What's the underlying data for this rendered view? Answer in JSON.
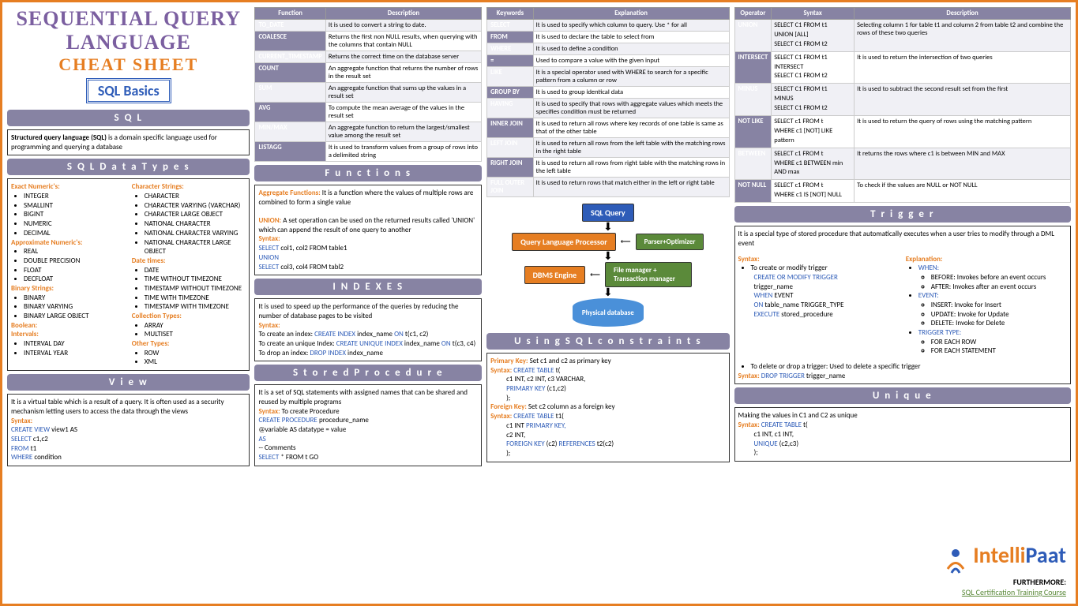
{
  "title": {
    "l1": "SEQUENTIAL QUERY",
    "l2": "LANGUAGE",
    "l3": "CHEAT SHEET",
    "badge": "SQL Basics"
  },
  "sql": {
    "hdr": "S Q L",
    "body": "Structured query language (SQL)",
    "body2": " is a domain specific language used for programming and querying a database"
  },
  "types": {
    "hdr": "S Q L   D a t a   T y p e s",
    "exact": {
      "t": "Exact Numeric's:",
      "i": [
        "INTEGER",
        "SMALLINT",
        "BIGINT",
        "NUMERIC",
        "DECIMAL"
      ]
    },
    "approx": {
      "t": "Approximate Numeric's:",
      "i": [
        "REAL",
        "DOUBLE PRECISION",
        "FLOAT",
        "DECFLOAT"
      ]
    },
    "binary": {
      "t": "Binary Strings:",
      "i": [
        "BINARY",
        "BINARY VARYING",
        "BINARY LARGE OBJECT"
      ]
    },
    "bool": {
      "t": "Boolean:"
    },
    "interval": {
      "t": "Intervals:",
      "i": [
        "INTERVAL DAY",
        "INTERVAL YEAR"
      ]
    },
    "char": {
      "t": "Character Strings:",
      "i": [
        "CHARACTER",
        "CHARACTER VARYING (VARCHAR)",
        "CHARACTER LARGE OBJECT",
        "NATIONAL CHARACTER",
        "NATIONAL CHARACTER VARYING",
        "NATIONAL CHARACTER LARGE OBJECT"
      ]
    },
    "date": {
      "t": "Date times:",
      "i": [
        "DATE",
        "TIME WITHOUT TIMEZONE",
        "TIMESTAMP WITHOUT TIMEZONE",
        "TIME WITH TIMEZONE",
        "TIMESTAMP WITH TIMEZONE"
      ]
    },
    "coll": {
      "t": "Collection Types:",
      "i": [
        "ARRAY",
        "MULTISET"
      ]
    },
    "other": {
      "t": "Other Types:",
      "i": [
        "ROW",
        "XML"
      ]
    }
  },
  "view": {
    "hdr": "V i e w",
    "body": "It is a virtual table which is a result of a query. It is often used as a security mechanism letting users to access the data through the views",
    "s": "Syntax:",
    "l1": "CREATE VIEW",
    "l1b": " view1 AS",
    "l2": "SELECT",
    "l2b": " c1,c2",
    "l3": "FROM",
    "l3b": " t1",
    "l4": "WHERE",
    "l4b": " condition"
  },
  "ftbl": {
    "h1": "Function",
    "h2": "Description",
    "rows": [
      [
        "TO_DATE",
        "It is used to convert a string to date."
      ],
      [
        "COALESCE",
        "Returns the first non NULL results, when querying with the columns that contain NULL"
      ],
      [
        "CURRENT_TIMESTAMP",
        "Returns the correct time on the database server"
      ],
      [
        "COUNT",
        "An aggregate function that returns the number of rows in the result set"
      ],
      [
        "SUM",
        "An aggregate function that sums up the values in a result set"
      ],
      [
        "AVG",
        "To compute the mean average of the values in the result set"
      ],
      [
        "MIN/MAX",
        "An aggregate function to return the largest/smallest value among the result set"
      ],
      [
        "LISTAGG",
        "It is used to transform values from a group of rows into a delimited string"
      ]
    ]
  },
  "func": {
    "hdr": "F u n c t i o n s",
    "af": "Aggregate Functions:",
    "afb": " It is a function where the values of multiple rows are combined to form a single value",
    "un": "UNION:",
    "unb": " A set operation can be used on the returned results called 'UNION' which can append the result of one query to another",
    "s": "Syntax:",
    "l1": "SELECT",
    "l1b": " col1, col2 FROM table1",
    "l2": "UNION",
    "l3": "SELECT",
    "l3b": " col3, col4 FROM tabl2"
  },
  "idx": {
    "hdr": "I N D E X E S",
    "body": "It is used to speed up the performance of the queries by reducing the number of database pages to be visited",
    "s": "Syntax:",
    "l1": "To create an index: ",
    "l1b": "CREATE INDEX",
    "l1c": " index_name ",
    "l1d": "ON",
    "l1e": " t(c1, c2)",
    "l2": "To create an unique Index: ",
    "l2b": "CREATE UNIQUE INDEX",
    "l2c": " index_name ",
    "l2d": "ON",
    "l2e": " t(c3, c4)",
    "l3": "To drop an index: ",
    "l3b": "DROP INDEX",
    "l3c": " index_name"
  },
  "sp": {
    "hdr": "S t o r e d   P r o c e d u r e",
    "body": "It is a set of SQL statements with assigned names that can be shared and reused by multiple programs",
    "s": "Syntax:",
    "sb": " To create Procedure",
    "l1": "CREATE PROCEDURE",
    "l1b": " procedure_name",
    "l2": "@variable AS datatype = value",
    "l3": "AS",
    "l4": "-- Comments",
    "l5": "SELECT",
    "l5b": " * FROM t GO"
  },
  "ktbl": {
    "h1": "Keywords",
    "h2": "Explanation",
    "rows": [
      [
        "SELECT",
        "It is used to specify which column to query. Use * for all"
      ],
      [
        "FROM",
        "It is used to declare the table to select from"
      ],
      [
        "WHERE",
        "It is used to define a condition"
      ],
      [
        "=",
        "Used to compare a value with the given input"
      ],
      [
        "LIKE",
        "It is a special operator used with WHERE to search for a specific pattern from a column or row"
      ],
      [
        "GROUP BY",
        "It is used to group identical data"
      ],
      [
        "HAVING",
        "It is used to specify that rows with aggregate values which meets the specifies condition must be returned"
      ],
      [
        "INNER JOIN",
        "It is used to return all rows where key records of one table is same as that of the other table"
      ],
      [
        "LEFT JOIN",
        "It is used to return all rows from the left table with the matching rows in the right table"
      ],
      [
        "RIGHT JOIN",
        "It is used to return all rows from right table with the matching rows in the left table"
      ],
      [
        "FULL OUTER JOIN",
        "It is used to return rows that match either in the left or right table"
      ]
    ]
  },
  "diag": {
    "q": "SQL Query",
    "p": "Query Language Processor",
    "po": "Parser+Optimizer",
    "e": "DBMS Engine",
    "fm": "File manager + Transaction manager",
    "d": "Physical database"
  },
  "con": {
    "hdr": "U s i n g   S Q L   c o n s t r a i n t s",
    "pk": "Primary Key:",
    "pkb": " Set c1 and c2 as primary key",
    "s": "Syntax: ",
    "ct": "CREATE TABLE",
    "l1": "c1 INT, c2 INT, c3 VARCHAR,",
    "l2": "PRIMARY KEY",
    "l2b": " (c1,c2)",
    "fk": "Foreign Key:",
    "fkb": " Set c2 column as a foreign key",
    "l3": "c1 INT ",
    "l3b": "PRIMARY KEY,",
    "l4": "c2 INT,",
    "l5": "FOREIGN KEY",
    "l5b": " (c2) ",
    "l5c": "REFERENCES",
    "l5d": " t2(c2)"
  },
  "otbl": {
    "h1": "Operator",
    "h2": "Syntax",
    "h3": "Description",
    "rows": [
      [
        "UNION",
        "SELECT C1 FROM t1\nUNION [ALL]\nSELECT C1 FROM t2",
        "Selecting column 1 for table t1 and column 2 from table t2 and combine the rows of these two queries"
      ],
      [
        "INTERSECT",
        "SELECT C1 FROM t1\nINTERSECT\nSELECT C1 FROM t2",
        "It is used to return the intersection of two queries"
      ],
      [
        "MINUS",
        "SELECT C1 FROM t1\nMINUS\nSELECT C1 FROM t2",
        "It is used to subtract the second result set from the first"
      ],
      [
        "NOT LIKE",
        "SELECT c1 FROM t\nWHERE c1 [NOT] LIKE pattern",
        "It is used to return the query of rows using the matching pattern"
      ],
      [
        "BETWEEN",
        "SELECT c1 FROM t\nWHERE c1 BETWEEN min AND max",
        "It returns the rows where c1 is between MIN and MAX"
      ],
      [
        "NOT NULL",
        "SELECT c1 FROM t\nWHERE c1 IS [NOT] NULL",
        "To check if the values are NULL or NOT NULL"
      ]
    ]
  },
  "trg": {
    "hdr": "T r i g g e r",
    "body": "It is a special type of stored procedure that automatically executes when a user tries to modify through a DML event",
    "s": "Syntax:",
    "l0": "To create or modify trigger",
    "l1": "CREATE OR MODIFY TRIGGER",
    "l1b": " trigger_name",
    "l2": "WHEN",
    "l2b": " EVENT",
    "l3": "ON",
    "l3b": " table_name TRIGGER_TYPE",
    "l4": "EXECUTE",
    "l4b": " stored_procedure",
    "e": "Explanation:",
    "w": "WHEN:",
    "wi": [
      "BEFORE: Invokes before an event occurs",
      "AFTER: Invokes after an event occurs"
    ],
    "ev": "EVENT:",
    "evi": [
      "INSERT: Invoke for Insert",
      "UPDATE: Invoke for Update",
      "DELETE: Invoke for Delete"
    ],
    "tt": "TRIGGER TYPE:",
    "tti": [
      "FOR EACH ROW",
      "FOR EACH STATEMENT"
    ],
    "del": "To delete or drop a trigger: Used to delete a specific trigger",
    "ds": "Syntax: ",
    "dc": "DROP TRIGGER",
    "dcb": " trigger_name"
  },
  "unq": {
    "hdr": "U n i q u e",
    "body": "Making the values in C1 and C2 as unique",
    "s": "Syntax: ",
    "ct": "CREATE TABLE",
    "l1": "c1 INT, c1 INT,",
    "l2": "UNIQUE",
    "l2b": " (c2,c3)"
  },
  "logo": {
    "brand1": "Intelli",
    "brand2": "Paat",
    "f": "FURTHERMORE:",
    "link": "SQL Certification Training Course"
  }
}
